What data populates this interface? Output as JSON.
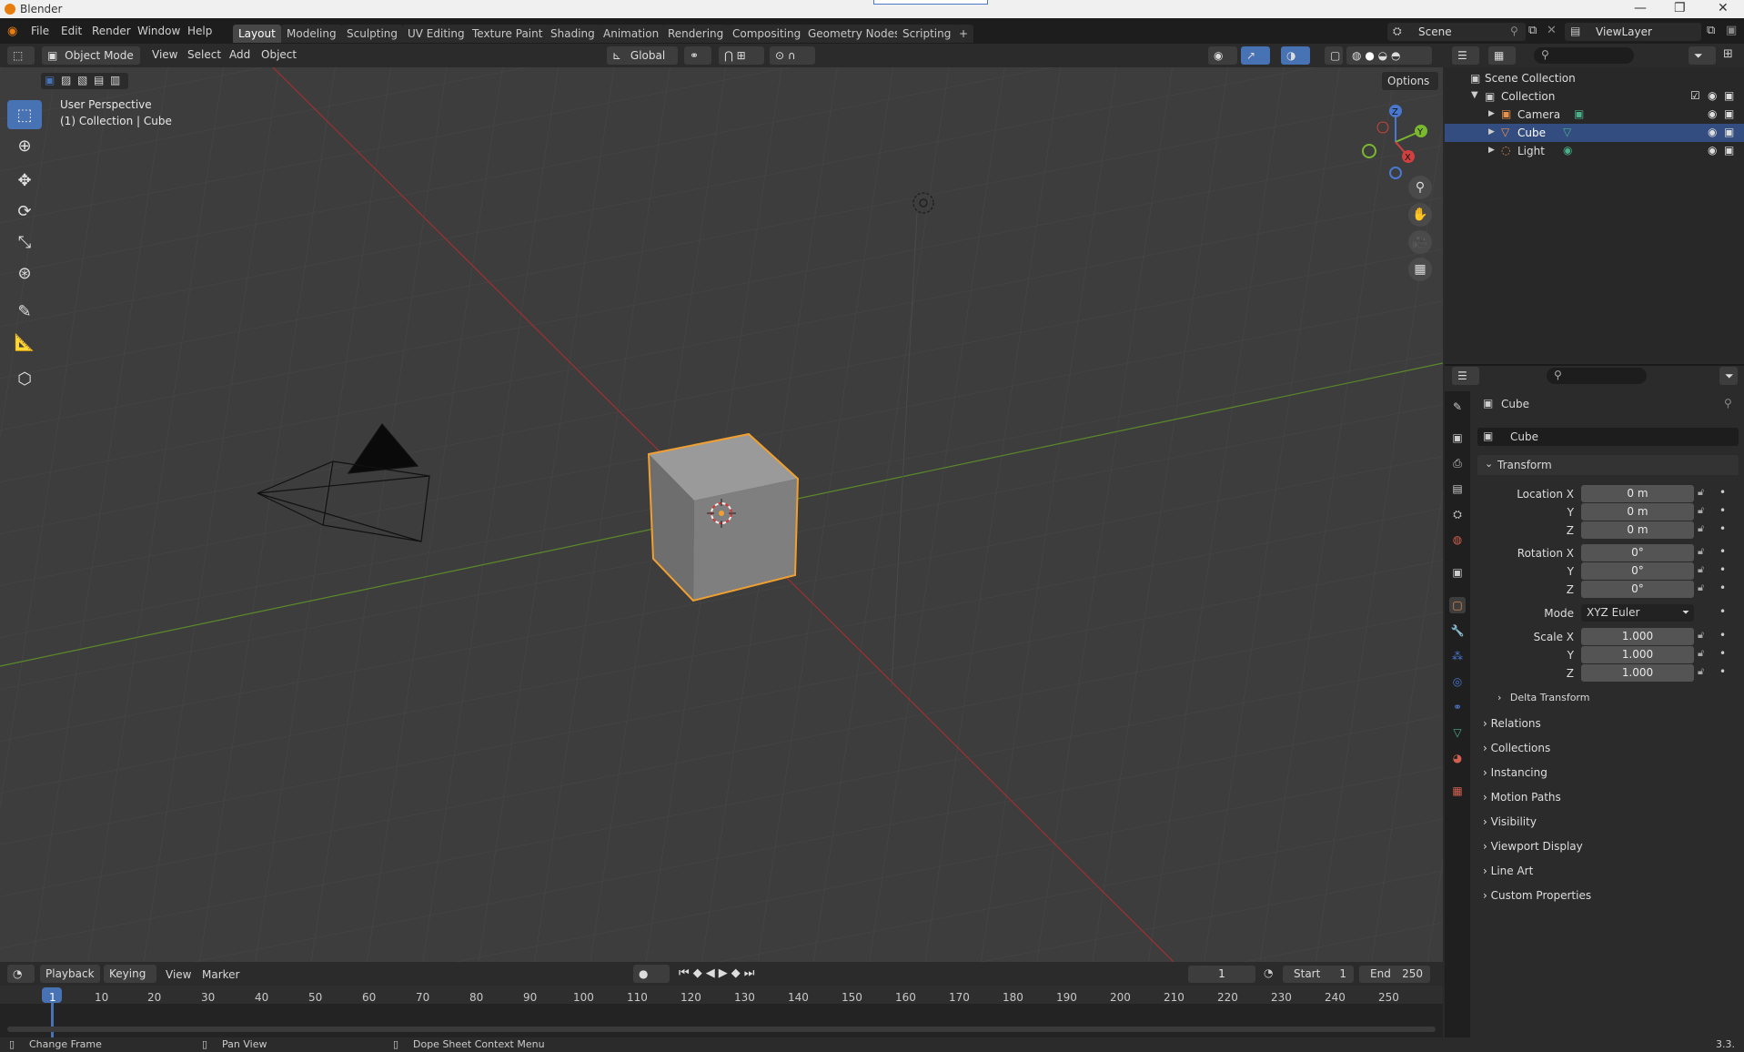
{
  "window": {
    "title": "Blender",
    "minimize": "—",
    "maximize": "❐",
    "close": "✕"
  },
  "menu": [
    "File",
    "Edit",
    "Render",
    "Window",
    "Help"
  ],
  "workspaces": [
    "Layout",
    "Modeling",
    "Sculpting",
    "UV Editing",
    "Texture Paint",
    "Shading",
    "Animation",
    "Rendering",
    "Compositing",
    "Geometry Nodes",
    "Scripting"
  ],
  "add_workspace": "+",
  "scene": "Scene",
  "view_layer": "ViewLayer",
  "viewport_header": {
    "mode": "Object Mode",
    "menus": [
      "View",
      "Select",
      "Add",
      "Object"
    ],
    "orientation": "Global",
    "options": "Options"
  },
  "viewport": {
    "perspective": "User Perspective",
    "collection_info": "(1) Collection | Cube",
    "gizmo": {
      "x": "X",
      "y": "Y",
      "z": "Z"
    }
  },
  "outliner": {
    "root": "Scene Collection",
    "collection": "Collection",
    "items": [
      "Camera",
      "Cube",
      "Light"
    ],
    "selected": "Cube"
  },
  "properties": {
    "object_name": "Cube",
    "datablock": "Cube",
    "transform_label": "Transform",
    "location_label": "Location X",
    "rotation_label": "Rotation X",
    "scale_label": "Scale X",
    "y_label": "Y",
    "z_label": "Z",
    "location": [
      "0 m",
      "0 m",
      "0 m"
    ],
    "rotation": [
      "0°",
      "0°",
      "0°"
    ],
    "mode_label": "Mode",
    "mode": "XYZ Euler",
    "scale": [
      "1.000",
      "1.000",
      "1.000"
    ],
    "delta_transform": "Delta Transform",
    "sections": [
      "Relations",
      "Collections",
      "Instancing",
      "Motion Paths",
      "Visibility",
      "Viewport Display",
      "Line Art",
      "Custom Properties"
    ]
  },
  "timeline": {
    "menus": [
      "Playback",
      "Keying",
      "View",
      "Marker"
    ],
    "current_frame": "1",
    "start_label": "Start",
    "start": "1",
    "end_label": "End",
    "end": "250",
    "ticks": [
      "1",
      "10",
      "20",
      "30",
      "40",
      "50",
      "60",
      "70",
      "80",
      "90",
      "100",
      "110",
      "120",
      "130",
      "140",
      "150",
      "160",
      "170",
      "180",
      "190",
      "200",
      "210",
      "220",
      "230",
      "240",
      "250"
    ]
  },
  "statusbar": {
    "items": [
      "Change Frame",
      "Pan View",
      "Dope Sheet Context Menu"
    ],
    "version": "3.3."
  },
  "colors": {
    "accent": "#4772b3",
    "selection_outline": "#f0a030",
    "x_axis": "#a03030",
    "y_axis": "#5a8a2a"
  }
}
